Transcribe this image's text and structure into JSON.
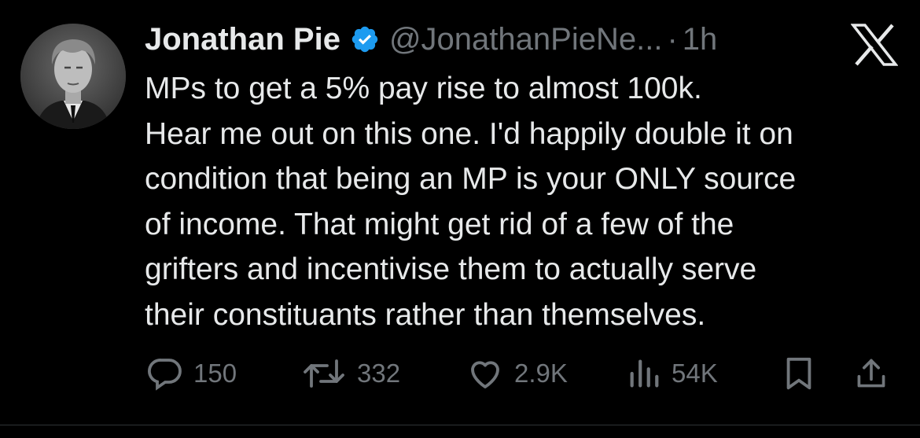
{
  "author": {
    "name": "Jonathan Pie",
    "handle": "@JonathanPieNe...",
    "separator": "·",
    "time": "1h"
  },
  "tweet": {
    "lines": [
      "MPs to get a 5% pay rise to almost 100k.",
      "Hear me out on this one. I'd happily double it on",
      "condition that being an MP is your ONLY source",
      "of income. That might get rid of a few of the",
      "grifters and incentivise them to actually serve",
      "their constituants rather than themselves."
    ]
  },
  "actions": {
    "replies": "150",
    "reposts": "332",
    "likes": "2.9K",
    "views": "54K"
  },
  "icons": {
    "brand": "x-logo-icon",
    "verified": "verified-badge-icon",
    "reply": "reply-icon",
    "repost": "repost-icon",
    "like": "heart-icon",
    "views": "views-icon",
    "bookmark": "bookmark-icon",
    "share": "share-icon"
  },
  "colors": {
    "background": "#000000",
    "text": "#e7e9ea",
    "muted": "#71767b",
    "verified": "#1d9bf0"
  }
}
